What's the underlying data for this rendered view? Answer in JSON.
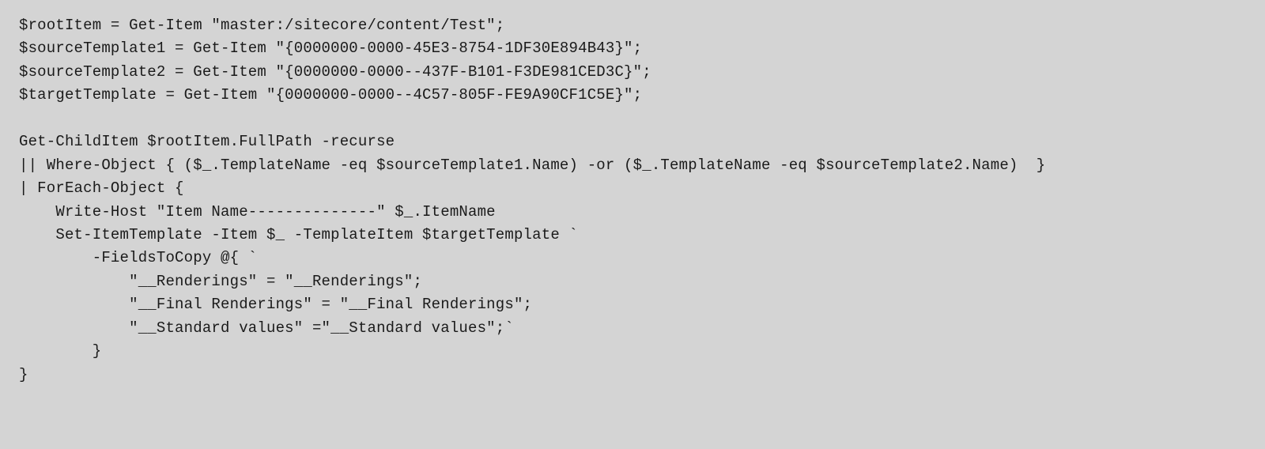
{
  "code": {
    "lines": [
      "$rootItem = Get-Item \"master:/sitecore/content/Test\";",
      "$sourceTemplate1 = Get-Item \"{0000000-0000-45E3-8754-1DF30E894B43}\";",
      "$sourceTemplate2 = Get-Item \"{0000000-0000--437F-B101-F3DE981CED3C}\";",
      "$targetTemplate = Get-Item \"{0000000-0000--4C57-805F-FE9A90CF1C5E}\";",
      "",
      "Get-ChildItem $rootItem.FullPath -recurse",
      "|| Where-Object { ($_.TemplateName -eq $sourceTemplate1.Name) -or ($_.TemplateName -eq $sourceTemplate2.Name)  }",
      "| ForEach-Object {",
      "    Write-Host \"Item Name--------------\" $_.ItemName",
      "    Set-ItemTemplate -Item $_ -TemplateItem $targetTemplate `",
      "        -FieldsToCopy @{ `",
      "            \"__Renderings\" = \"__Renderings\";",
      "            \"__Final Renderings\" = \"__Final Renderings\";",
      "            \"__Standard values\" =\"__Standard values\";`",
      "        }",
      "}"
    ]
  }
}
